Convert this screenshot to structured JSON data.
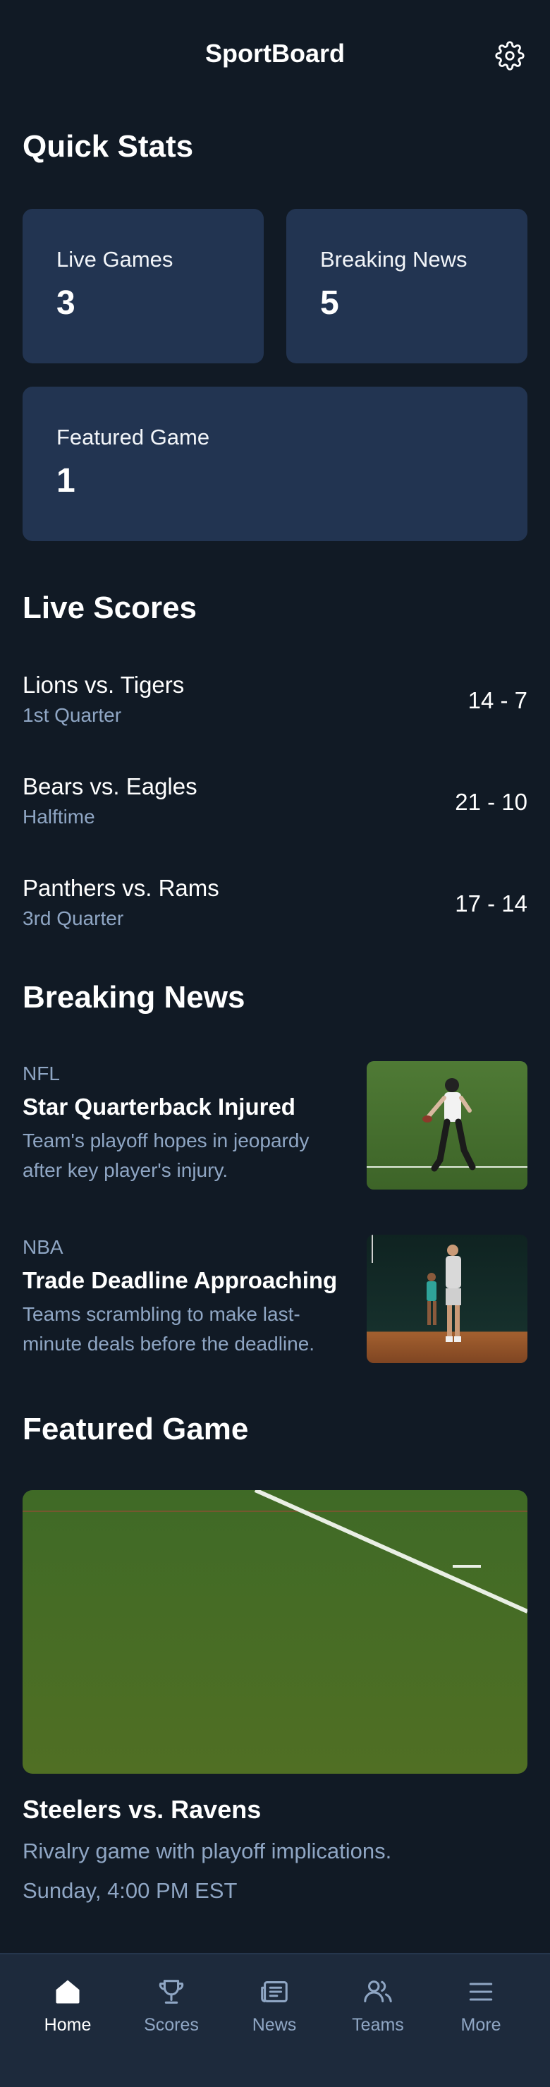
{
  "header": {
    "title": "SportBoard",
    "settings_icon": "gear-icon"
  },
  "quick_stats": {
    "title": "Quick Stats",
    "cards": [
      {
        "label": "Live Games",
        "value": "3"
      },
      {
        "label": "Breaking News",
        "value": "5"
      },
      {
        "label": "Featured Game",
        "value": "1"
      }
    ]
  },
  "live_scores": {
    "title": "Live Scores",
    "games": [
      {
        "teams": "Lions vs. Tigers",
        "period": "1st Quarter",
        "score": "14 - 7"
      },
      {
        "teams": "Bears vs. Eagles",
        "period": "Halftime",
        "score": "21 - 10"
      },
      {
        "teams": "Panthers vs. Rams",
        "period": "3rd Quarter",
        "score": "17 - 14"
      }
    ]
  },
  "breaking_news": {
    "title": "Breaking News",
    "items": [
      {
        "category": "NFL",
        "headline": "Star Quarterback Injured",
        "summary": "Team's playoff hopes in jeopardy after key player's injury.",
        "image_icon": "football-player-photo"
      },
      {
        "category": "NBA",
        "headline": "Trade Deadline Approaching",
        "summary": "Teams scrambling to make last-minute deals before the deadline.",
        "image_icon": "basketball-players-photo"
      }
    ]
  },
  "featured_game": {
    "title": "Featured Game",
    "image_icon": "football-field-photo",
    "matchup": "Steelers vs. Ravens",
    "description": "Rivalry game with playoff implications.",
    "time": "Sunday, 4:00 PM EST"
  },
  "bottom_nav": {
    "items": [
      {
        "label": "Home",
        "icon": "home-icon",
        "active": true
      },
      {
        "label": "Scores",
        "icon": "trophy-icon",
        "active": false
      },
      {
        "label": "News",
        "icon": "newspaper-icon",
        "active": false
      },
      {
        "label": "Teams",
        "icon": "users-icon",
        "active": false
      },
      {
        "label": "More",
        "icon": "menu-icon",
        "active": false
      }
    ]
  },
  "colors": {
    "background": "#111a25",
    "card": "#223451",
    "muted_text": "#8fa6c4",
    "nav_background": "#1d2a3c"
  }
}
